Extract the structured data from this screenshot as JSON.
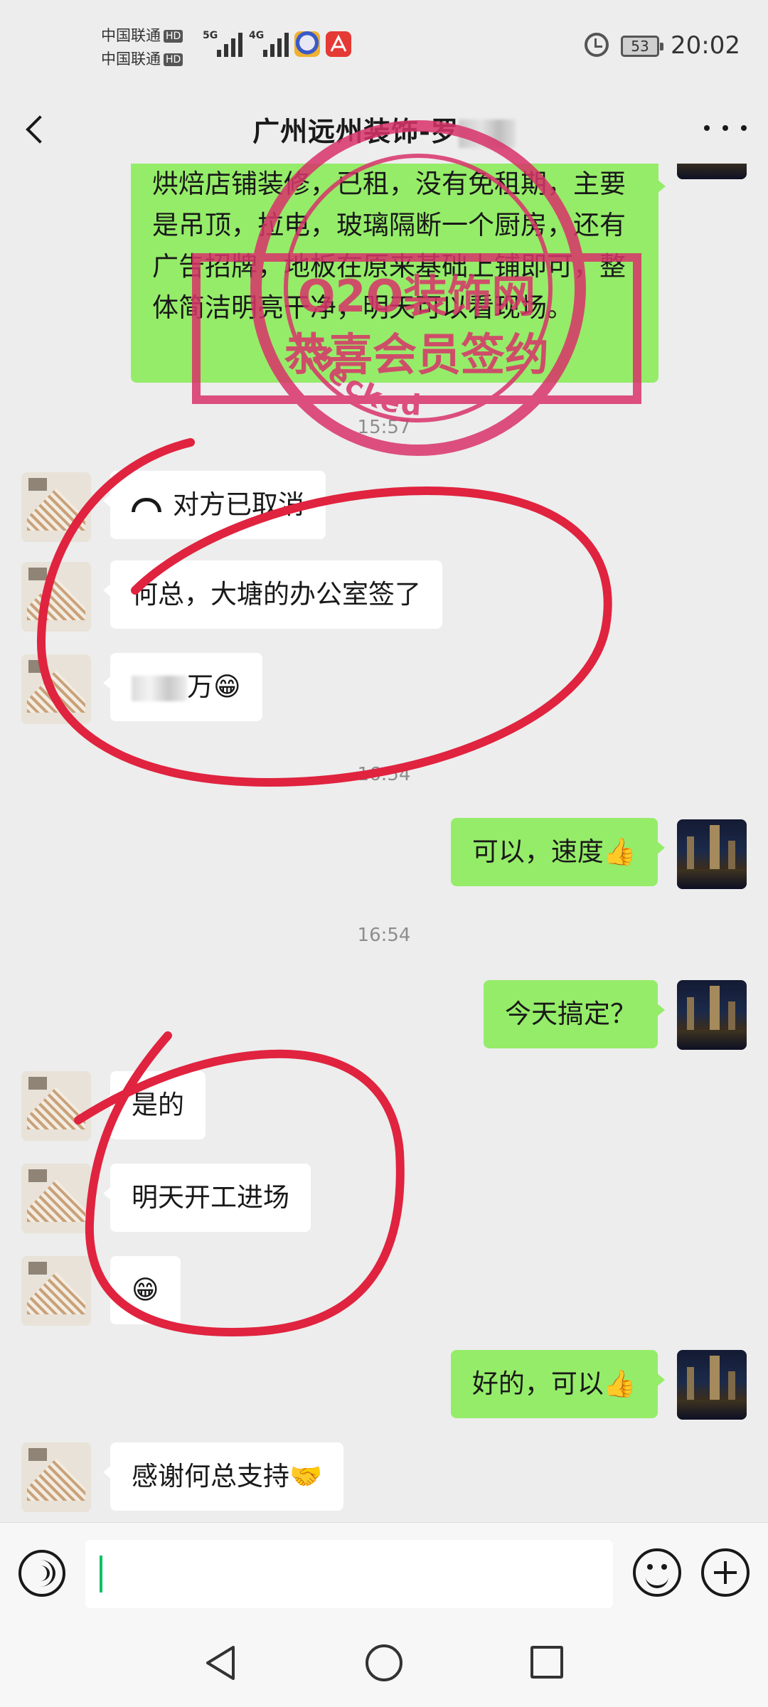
{
  "status_bar": {
    "carrier_1": "中国联通",
    "carrier_2": "中国联通",
    "hd_badge": "HD",
    "net_1": "5G",
    "net_2": "4G",
    "battery": "53",
    "time": "20:02"
  },
  "header": {
    "title": "广州远州装饰-罗"
  },
  "stamp": {
    "line1": "O2O装饰网",
    "line2": "恭喜会员签约",
    "ring_text": "checked",
    "color": "#d8336a"
  },
  "messages": [
    {
      "side": "me",
      "text": "烘焙店铺装修，已租，没有免租期，主要是吊顶，拉电，玻璃隔断一个厨房，还有广告招牌，地板在原来基础上铺即可，整体简洁明亮干净，明天可以看现场。"
    },
    {
      "type": "time",
      "text": "15:57"
    },
    {
      "side": "them",
      "text": "对方已取消",
      "icon": "call-icon"
    },
    {
      "side": "them",
      "text": "何总，大塘的办公室签了"
    },
    {
      "side": "them",
      "text": "万😁"
    },
    {
      "type": "time",
      "text": "16:54"
    },
    {
      "side": "me",
      "text": "可以，速度👍"
    },
    {
      "type": "time",
      "text": "16:54"
    },
    {
      "side": "me",
      "text": "今天搞定？"
    },
    {
      "side": "them",
      "text": "是的"
    },
    {
      "side": "them",
      "text": "明天开工进场"
    },
    {
      "side": "them",
      "text": "😁"
    },
    {
      "side": "me",
      "text": "好的，可以👍"
    },
    {
      "side": "them",
      "text": "感谢何总支持🤝"
    }
  ],
  "colors": {
    "background": "#ededed",
    "bubble_me": "#95ec69",
    "bubble_them": "#ffffff",
    "annotation": "#e0233f",
    "caret": "#07c160"
  }
}
